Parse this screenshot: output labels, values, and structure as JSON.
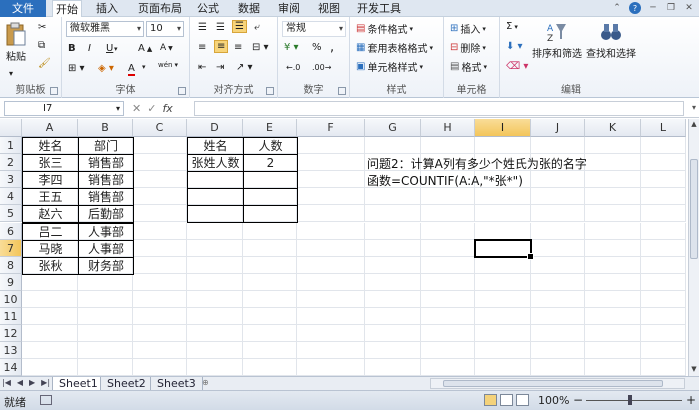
{
  "menu": {
    "file": "文件",
    "tabs": [
      "开始",
      "插入",
      "页面布局",
      "公式",
      "数据",
      "审阅",
      "视图",
      "开发工具"
    ],
    "active_tab": "开始"
  },
  "ribbon": {
    "clipboard": {
      "paste": "粘贴",
      "label": "剪贴板"
    },
    "font": {
      "name": "微软雅黑",
      "size": "10",
      "bold": "B",
      "italic": "I",
      "underline": "U",
      "grow": "A",
      "shrink": "A",
      "font_color": "A",
      "phonetic": "wén",
      "label": "字体"
    },
    "alignment": {
      "label": "对齐方式"
    },
    "number": {
      "format": "常规",
      "percent": "%",
      "comma": ",",
      "label": "数字"
    },
    "styles": {
      "conditional": "条件格式",
      "table": "套用表格格式",
      "cell": "单元格样式",
      "label": "样式"
    },
    "cells": {
      "insert": "插入",
      "delete": "删除",
      "format": "格式",
      "label": "单元格"
    },
    "editing": {
      "sum": "Σ",
      "sort_filter": "排序和筛选",
      "find_select": "查找和选择",
      "label": "编辑"
    }
  },
  "formula_bar": {
    "name_box": "I7",
    "fx": "fx",
    "formula": ""
  },
  "columns": [
    "A",
    "B",
    "C",
    "D",
    "E",
    "F",
    "G",
    "H",
    "I",
    "J",
    "K",
    "L"
  ],
  "rows": [
    "1",
    "2",
    "3",
    "4",
    "5",
    "6",
    "7",
    "8",
    "9",
    "10",
    "11",
    "12",
    "13",
    "14"
  ],
  "selected": {
    "column": "I",
    "row": "7"
  },
  "table_ab": [
    [
      "姓名",
      "部门"
    ],
    [
      "张三",
      "销售部"
    ],
    [
      "李四",
      "销售部"
    ],
    [
      "王五",
      "销售部"
    ],
    [
      "赵六",
      "后勤部"
    ],
    [
      "吕二",
      "人事部"
    ],
    [
      "马晓",
      "人事部"
    ],
    [
      "张秋",
      "财务部"
    ]
  ],
  "table_de": [
    [
      "姓名",
      "人数"
    ],
    [
      "张姓人数",
      "2"
    ],
    [
      "",
      ""
    ],
    [
      "",
      ""
    ],
    [
      "",
      ""
    ]
  ],
  "notes": {
    "question": "问题2：计算A列有多少个姓氏为张的名字",
    "function": "函数=COUNTIF(A:A,\"*张*\")"
  },
  "sheets": [
    "Sheet1",
    "Sheet2",
    "Sheet3"
  ],
  "active_sheet": "Sheet1",
  "status": {
    "ready": "就绪",
    "zoom": "100%",
    "minus": "−",
    "plus": "+"
  }
}
